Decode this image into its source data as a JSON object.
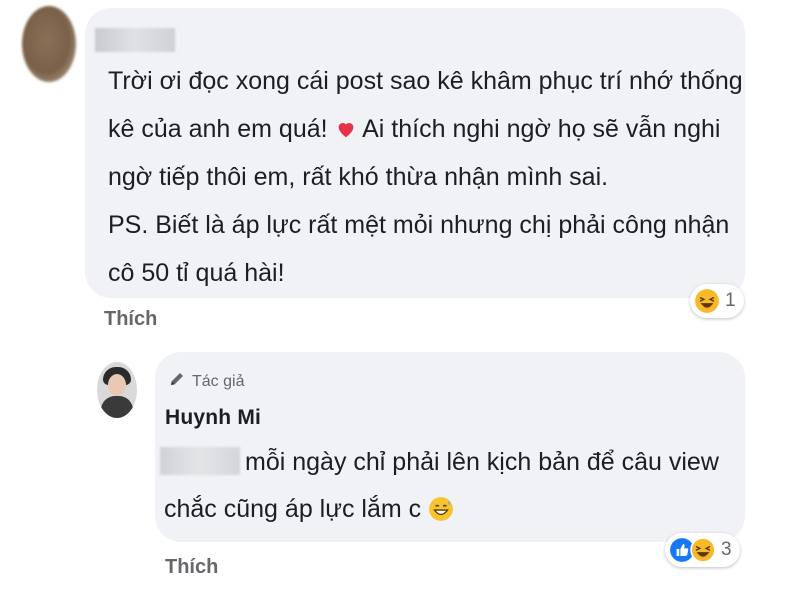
{
  "comment": {
    "lines": [
      "Trời ơi đọc xong cái post sao kê khâm phục trí nhớ thống",
      "kê của anh em quá!",
      "Ai thích nghi ngờ họ sẽ vẫn nghi",
      "ngờ tiếp thôi em, rất khó thừa nhận mình sai.",
      "PS. Biết là áp lực rất mệt mỏi nhưng chị phải công nhận",
      "cô 50 tỉ quá hài!"
    ],
    "like_label": "Thích",
    "reaction_count": "1",
    "reaction_icons": [
      "haha-icon"
    ],
    "emoji_icons": [
      "red-heart-icon"
    ]
  },
  "reply": {
    "author_badge": "Tác giả",
    "author_name": "Huynh Mi",
    "lines": [
      "mỗi ngày chỉ phải lên kịch bản để câu view",
      "chắc cũng áp lực lắm c"
    ],
    "like_label": "Thích",
    "reaction_count": "3",
    "reaction_icons": [
      "like-icon",
      "haha-icon"
    ],
    "emoji_icons": [
      "grinning-sweat-icon"
    ]
  },
  "colors": {
    "bubble": "#f0f2f5",
    "muted_text": "#65676b",
    "like_blue": "#1877f2",
    "haha_yellow": "#f7b928",
    "heart_red": "#e8324a"
  }
}
